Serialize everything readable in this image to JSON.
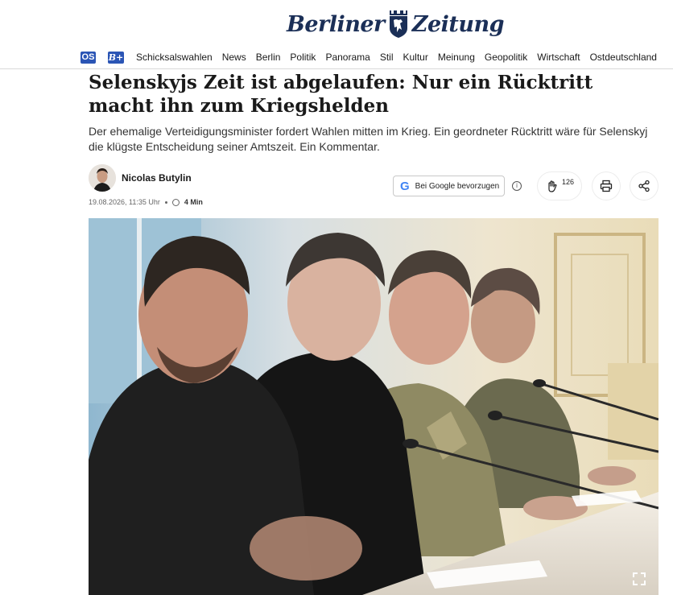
{
  "masthead": {
    "logo_left": "Berliner",
    "logo_right": "Zeitung"
  },
  "nav": {
    "badge_os": "OS",
    "badge_bplus": "B+",
    "items": [
      "Schicksalswahlen",
      "News",
      "Berlin",
      "Politik",
      "Panorama",
      "Stil",
      "Kultur",
      "Meinung",
      "Geopolitik",
      "Wirtschaft",
      "Ostdeutschland"
    ]
  },
  "article": {
    "headline": "Selenskyjs Zeit ist abgelaufen: Nur ein Rücktritt macht ihn zum Kriegshelden",
    "lead": "Der ehemalige Verteidigungsminister fordert Wahlen mitten im Krieg. Ein geordneter Rücktritt wäre für Selenskyj die klügste Entscheidung seiner Amtszeit. Ein Kommentar.",
    "author": "Nicolas Butylin",
    "date": "19.08.2026, 11:35 Uhr",
    "read_time": "4 Min"
  },
  "actions": {
    "google_label": "Bei Google bevorzugen",
    "google_glyph": "G",
    "info_glyph": "i",
    "clap_count": "126"
  },
  "icons": {
    "clap": "clap-icon",
    "print": "printer-icon",
    "share": "share-icon",
    "fullscreen": "fullscreen-icon"
  },
  "colors": {
    "brand": "#1b2f57",
    "badge": "#2b55b5"
  }
}
